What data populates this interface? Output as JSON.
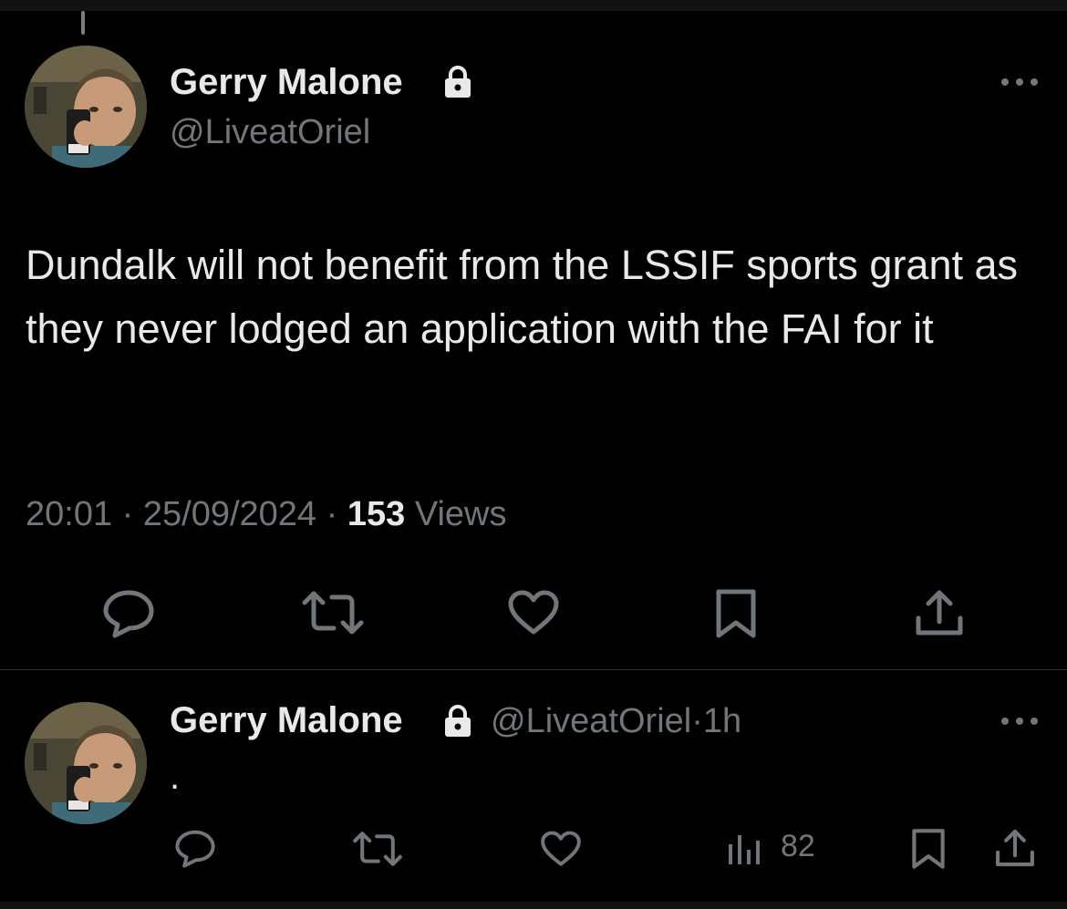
{
  "main_tweet": {
    "author_name": "Gerry Malone",
    "handle": "@LiveatOriel",
    "text": "Dundalk will not benefit from the LSSIF sports grant as they never lodged an application with the FAI for it",
    "time": "20:01",
    "separator": "·",
    "date": "25/09/2024",
    "views_count": "153",
    "views_label": "Views"
  },
  "reply_tweet": {
    "author_name": "Gerry Malone",
    "handle": "@LiveatOriel",
    "age": "1h",
    "separator": "·",
    "text": ".",
    "views_count": "82"
  },
  "icons": {
    "lock": "lock-icon",
    "more": "more-icon",
    "reply": "reply-icon",
    "retweet": "retweet-icon",
    "like": "heart-icon",
    "bookmark": "bookmark-icon",
    "share": "share-icon",
    "views": "analytics-icon"
  },
  "colors": {
    "background": "#000000",
    "text_primary": "#e7e9ea",
    "text_secondary": "#71767b",
    "divider": "#2f3336"
  }
}
